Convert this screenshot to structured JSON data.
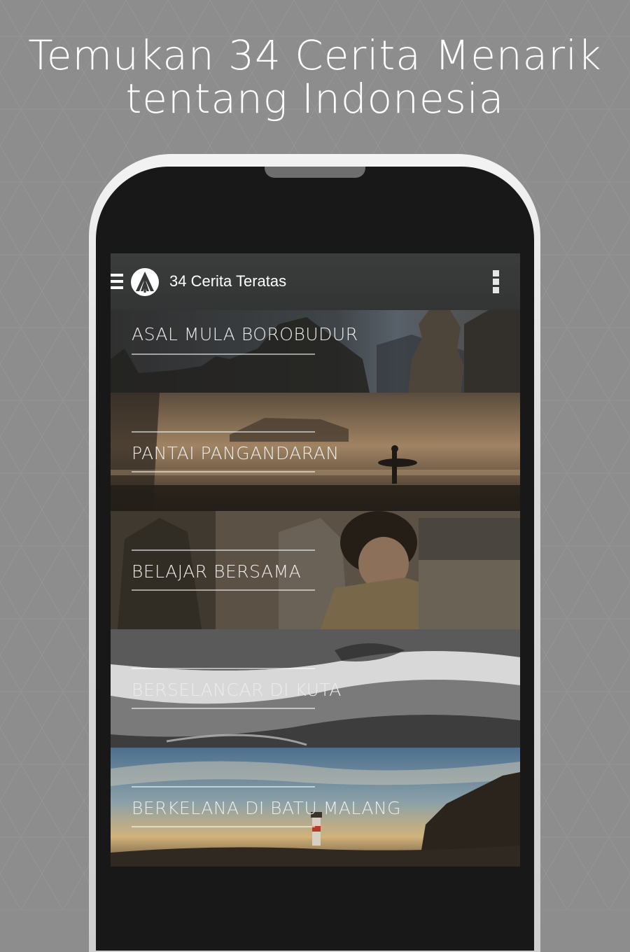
{
  "headline": {
    "line1": "Temukan 34 Cerita Menarik",
    "line2": "tentang Indonesia"
  },
  "app_bar": {
    "title": "34 Cerita Teratas",
    "menu_icon": "hamburger-menu-icon",
    "logo_icon": "app-logo-icon",
    "overflow_icon": "overflow-menu-icon"
  },
  "stories": [
    {
      "title": "ASAL MULA BOROBUDUR"
    },
    {
      "title": "PANTAI PANGANDARAN"
    },
    {
      "title": "BELAJAR BERSAMA"
    },
    {
      "title": "BERSELANCAR DI KUTA"
    },
    {
      "title": "BERKELANA DI BATU MALANG"
    }
  ],
  "colors": {
    "background": "#8d8d8d",
    "phone_body": "#181818",
    "action_bar": "#373939",
    "text": "#ffffff"
  }
}
